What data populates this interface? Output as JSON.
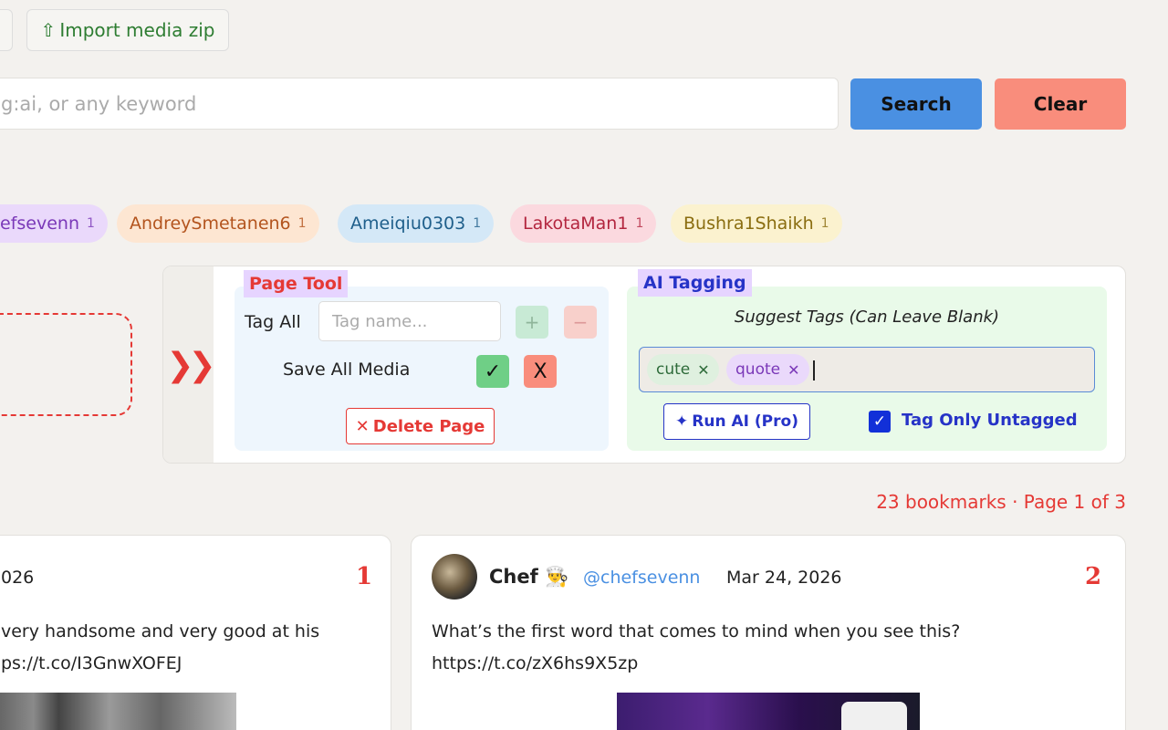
{
  "toolbar": {
    "import_label": "Import media zip",
    "import_icon": "⇧"
  },
  "search": {
    "placeholder": "g:ai, or any keyword",
    "search_label": "Search",
    "clear_label": "Clear"
  },
  "chips": [
    {
      "name": "efsevenn",
      "count": "1",
      "bg": "#ead9fb",
      "fg": "#7a38b8"
    },
    {
      "name": "AndreySmetanen6",
      "count": "1",
      "bg": "#fde6d2",
      "fg": "#b3541e"
    },
    {
      "name": "Ameiqiu0303",
      "count": "1",
      "bg": "#d4e8f7",
      "fg": "#1f5f8b"
    },
    {
      "name": "LakotaMan1",
      "count": "1",
      "bg": "#fbd9df",
      "fg": "#b3263f"
    },
    {
      "name": "Bushra1Shaikh",
      "count": "1",
      "bg": "#fbf2cf",
      "fg": "#8a6d10"
    }
  ],
  "tools": {
    "toggle_icon": "❯❯",
    "page_tool": {
      "title": "Page Tool",
      "tag_all_label": "Tag All",
      "tag_name_placeholder": "Tag name...",
      "plus": "+",
      "minus": "−",
      "save_all_label": "Save All Media",
      "check": "✓",
      "x": "X",
      "delete_label": "Delete Page",
      "delete_icon": "✕"
    },
    "ai_tagging": {
      "title": "AI Tagging",
      "suggest_label": "Suggest Tags (Can Leave Blank)",
      "tags": [
        {
          "label": "cute",
          "remove": "✕"
        },
        {
          "label": "quote",
          "remove": "✕"
        }
      ],
      "run_label": "Run AI (Pro)",
      "run_icon": "✦",
      "untagged_label": "Tag Only Untagged",
      "untagged_checked": true,
      "check_mark": "✓"
    }
  },
  "status": {
    "bookmarks_text": "23 bookmarks · Page 1 of 3"
  },
  "cards": [
    {
      "index": "1",
      "date_partial": "026",
      "text_line1": "very handsome and very good at his",
      "text_line2": "ps://t.co/I3GnwXOFEJ"
    },
    {
      "index": "2",
      "author": "Chef 👨‍🍳",
      "handle": "@chefsevenn",
      "date": "Mar 24, 2026",
      "text_line1": "What’s the first word that comes to mind when you see this?",
      "text_line2": "https://t.co/zX6hs9X5zp"
    }
  ]
}
